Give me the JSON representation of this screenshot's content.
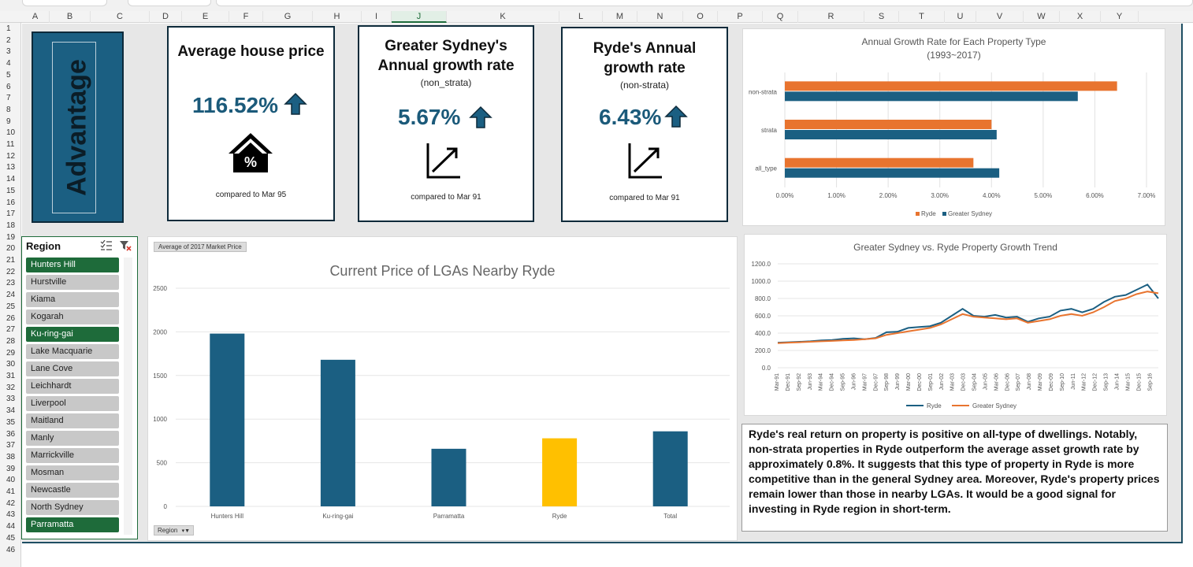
{
  "columns": [
    "A",
    "B",
    "C",
    "D",
    "E",
    "F",
    "G",
    "H",
    "I",
    "J",
    "K",
    "L",
    "M",
    "N",
    "O",
    "P",
    "Q",
    "R",
    "S",
    "T",
    "U",
    "V",
    "W",
    "X",
    "Y"
  ],
  "rows": [
    "1",
    "2",
    "3",
    "4",
    "5",
    "6",
    "7",
    "8",
    "9",
    "10",
    "11",
    "12",
    "13",
    "14",
    "15",
    "16",
    "17",
    "18",
    "19",
    "20",
    "21",
    "22",
    "23",
    "24",
    "25",
    "26",
    "27",
    "28",
    "29",
    "30",
    "31",
    "32",
    "33",
    "34",
    "35",
    "36",
    "37",
    "38",
    "39",
    "40",
    "41",
    "42",
    "43",
    "44",
    "45",
    "46"
  ],
  "banner": {
    "text": "Advantage"
  },
  "kpi1": {
    "title": "Average house price",
    "value": "116.52%",
    "note": "compared to Mar 95",
    "icon": "house-percent-icon"
  },
  "kpi2": {
    "title": "Greater Sydney's Annual growth rate",
    "subtitle": "(non_strata)",
    "value": "5.67%",
    "note": "compared to Mar 91",
    "icon": "trend-up-icon"
  },
  "kpi3": {
    "title": "Ryde's Annual growth rate",
    "subtitle": "(non-strata)",
    "value": "6.43%",
    "note": "compared to Mar 91",
    "icon": "trend-up-icon"
  },
  "slicer": {
    "title": "Region",
    "items": [
      {
        "label": "Hunters Hill",
        "selected": true
      },
      {
        "label": "Hurstville",
        "selected": false
      },
      {
        "label": "Kiama",
        "selected": false
      },
      {
        "label": "Kogarah",
        "selected": false
      },
      {
        "label": "Ku-ring-gai",
        "selected": true
      },
      {
        "label": "Lake Macquarie",
        "selected": false
      },
      {
        "label": "Lane Cove",
        "selected": false
      },
      {
        "label": "Leichhardt",
        "selected": false
      },
      {
        "label": "Liverpool",
        "selected": false
      },
      {
        "label": "Maitland",
        "selected": false
      },
      {
        "label": "Manly",
        "selected": false
      },
      {
        "label": "Marrickville",
        "selected": false
      },
      {
        "label": "Mosman",
        "selected": false
      },
      {
        "label": "Newcastle",
        "selected": false
      },
      {
        "label": "North Sydney",
        "selected": false
      },
      {
        "label": "Parramatta",
        "selected": true
      }
    ]
  },
  "pivot": {
    "field_button": "Average of 2017 Market Price",
    "filter_button": "Region"
  },
  "colors": {
    "navy": "#1b5f82",
    "orange": "#e8742f",
    "yellow": "#ffc000",
    "green": "#1e6b3a"
  },
  "chart_data": [
    {
      "type": "bar",
      "orientation": "horizontal",
      "title": "Annual Growth Rate for Each Property Type",
      "subtitle": "(1993~2017)",
      "categories": [
        "non-strata",
        "strata",
        "all_type"
      ],
      "series": [
        {
          "name": "Ryde",
          "color": "#e8742f",
          "values": [
            6.43,
            4.0,
            3.65
          ]
        },
        {
          "name": "Greater Sydney",
          "color": "#1b5f82",
          "values": [
            5.67,
            4.1,
            4.15
          ]
        }
      ],
      "xticks": [
        "0.00%",
        "1.00%",
        "2.00%",
        "3.00%",
        "4.00%",
        "5.00%",
        "6.00%",
        "7.00%"
      ],
      "xlim": [
        0,
        7
      ],
      "legend": "bottom",
      "grid": true
    },
    {
      "type": "bar",
      "title": "Current Price of LGAs Nearby Ryde",
      "categories": [
        "Hunters Hill",
        "Ku-ring-gai",
        "Parramatta",
        "Ryde",
        "Total"
      ],
      "values": [
        1980,
        1680,
        660,
        780,
        860
      ],
      "colors": [
        "#1b5f82",
        "#1b5f82",
        "#1b5f82",
        "#ffc000",
        "#1b5f82"
      ],
      "yticks": [
        "0",
        "500",
        "1000",
        "1500",
        "2000",
        "2500"
      ],
      "ylim": [
        0,
        2500
      ],
      "grid": true
    },
    {
      "type": "line",
      "title": "Greater Sydney vs. Ryde Property Growth Trend",
      "xticks": [
        "Mar-91",
        "Dec-91",
        "Sep-92",
        "Jun-93",
        "Mar-94",
        "Dec-94",
        "Sep-95",
        "Jun-96",
        "Mar-97",
        "Dec-97",
        "Sep-98",
        "Jun-99",
        "Mar-00",
        "Dec-00",
        "Sep-01",
        "Jun-02",
        "Mar-03",
        "Dec-03",
        "Sep-04",
        "Jun-05",
        "Mar-06",
        "Dec-06",
        "Sep-07",
        "Jun-08",
        "Mar-09",
        "Dec-09",
        "Sep-10",
        "Jun-11",
        "Mar-12",
        "Dec-12",
        "Sep-13",
        "Jun-14",
        "Mar-15",
        "Dec-15",
        "Sep-16"
      ],
      "yticks": [
        "0.0",
        "200.0",
        "400.0",
        "600.0",
        "800.0",
        "1000.0",
        "1200.0"
      ],
      "ylim": [
        0,
        1200
      ],
      "legend": "bottom",
      "series": [
        {
          "name": "Ryde",
          "color": "#1b5f82",
          "values": [
            290,
            295,
            300,
            305,
            315,
            320,
            335,
            340,
            330,
            345,
            410,
            415,
            460,
            470,
            480,
            520,
            600,
            680,
            600,
            590,
            610,
            580,
            590,
            530,
            570,
            590,
            660,
            680,
            640,
            680,
            760,
            820,
            840,
            900,
            960,
            800
          ]
        },
        {
          "name": "Greater Sydney",
          "color": "#e8742f",
          "values": [
            285,
            290,
            295,
            300,
            305,
            310,
            315,
            320,
            330,
            340,
            380,
            400,
            420,
            440,
            460,
            500,
            560,
            620,
            590,
            580,
            570,
            560,
            570,
            520,
            540,
            560,
            600,
            620,
            600,
            640,
            700,
            770,
            800,
            850,
            880,
            860
          ]
        }
      ]
    }
  ],
  "commentary": {
    "text": "Ryde's real return on property is positive on all-type of dwellings. Notably, non-strata properties in Ryde outperform the average asset growth rate by approximately 0.8%. It suggests that this type of property in Ryde is more competitive than in the general Sydney area. Moreover, Ryde's property prices remain lower than those in nearby LGAs. It would be a good signal for investing in Ryde region in short-term."
  }
}
